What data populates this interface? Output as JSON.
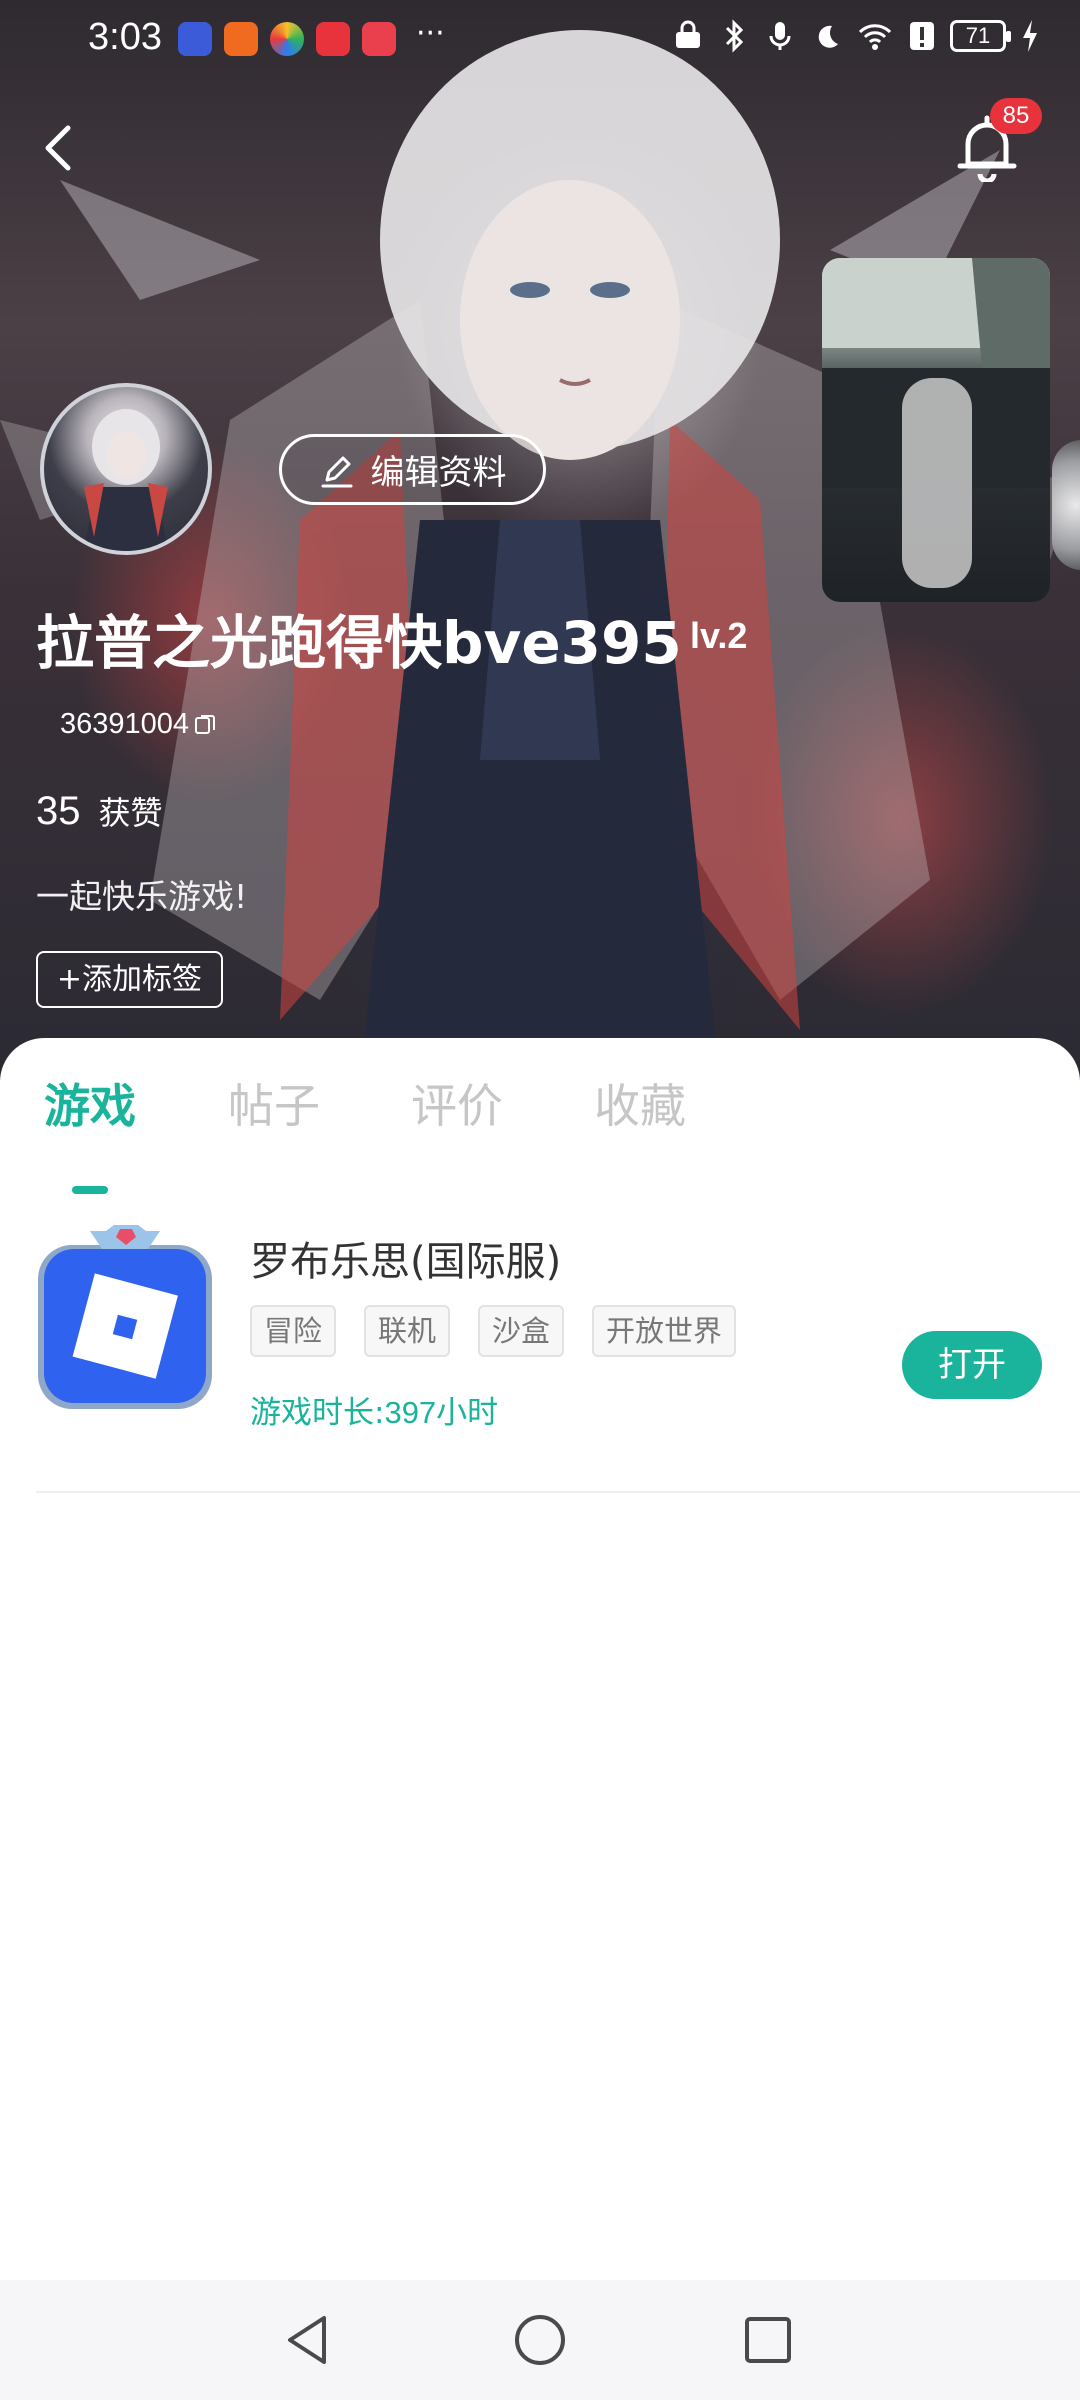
{
  "status_bar": {
    "time": "3:03",
    "battery": "71",
    "more": "···"
  },
  "header": {
    "notification_count": "85"
  },
  "profile": {
    "edit_label": "编辑资料",
    "name": "拉普之光跑得快bve395",
    "level": "lv.2",
    "user_id": "36391004",
    "likes_count": "35",
    "likes_label": "获赞",
    "bio": "一起快乐游戏!",
    "add_tag_label": "+添加标签"
  },
  "tabs": [
    {
      "label": "游戏",
      "active": true
    },
    {
      "label": "帖子",
      "active": false
    },
    {
      "label": "评价",
      "active": false
    },
    {
      "label": "收藏",
      "active": false
    }
  ],
  "games": [
    {
      "title": "罗布乐思(国际服)",
      "tags": [
        "冒险",
        "联机",
        "沙盒",
        "开放世界"
      ],
      "play_time_label": "游戏时长:",
      "play_time_value": "397小时",
      "action_label": "打开"
    }
  ],
  "colors": {
    "accent": "#1ab39c",
    "badge": "#e8323c",
    "tab_inactive": "#c6c6c6"
  },
  "icons": {
    "back": "chevron-left-icon",
    "notification": "bell-icon",
    "edit": "pencil-icon",
    "copy": "copy-icon",
    "game": "roblox-icon"
  }
}
